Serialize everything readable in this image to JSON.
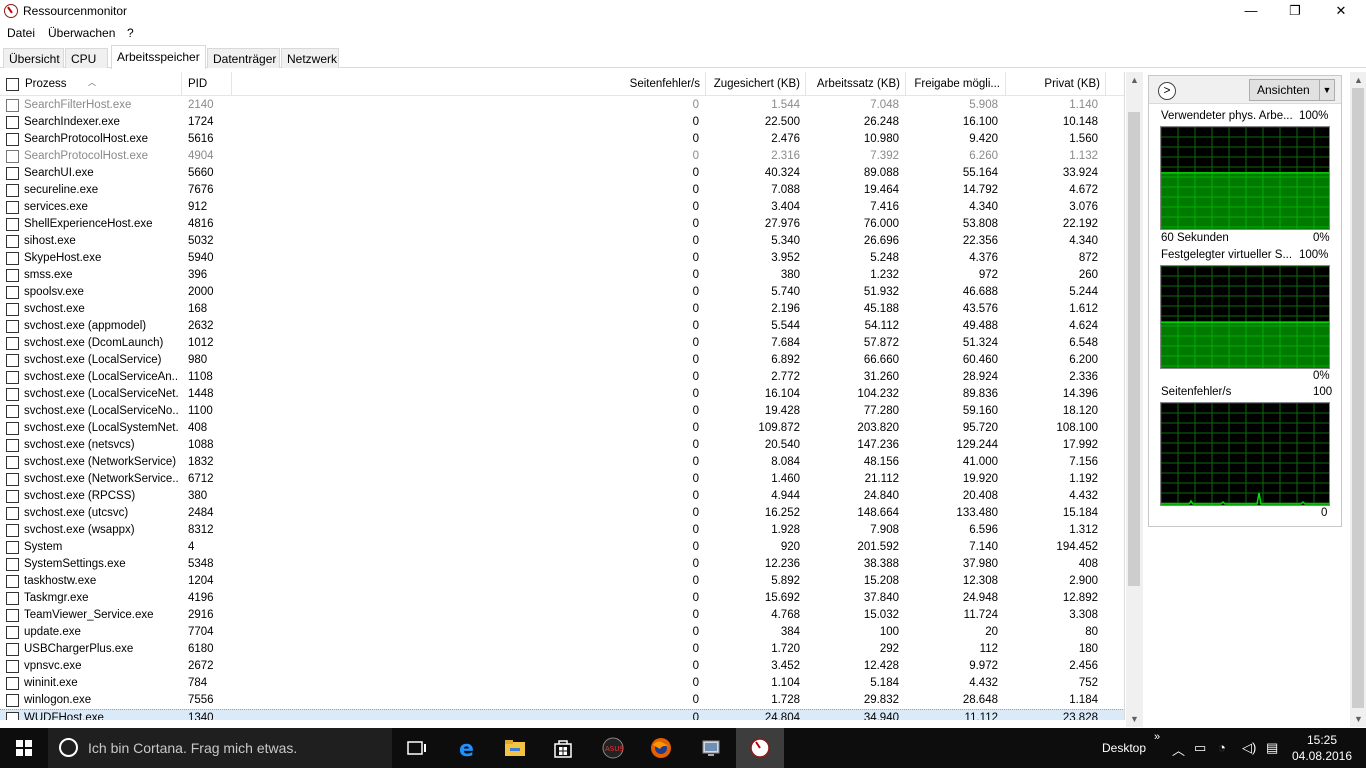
{
  "window": {
    "title": "Ressourcenmonitor",
    "min": "—",
    "max": "❐",
    "close": "✕"
  },
  "menu": [
    "Datei",
    "Überwachen",
    "?"
  ],
  "tabs": [
    "Übersicht",
    "CPU",
    "Arbeitsspeicher",
    "Datenträger",
    "Netzwerk"
  ],
  "active_tab": "Arbeitsspeicher",
  "columns": [
    "Prozess",
    "PID",
    "Seitenfehler/s",
    "Zugesichert (KB)",
    "Arbeitssatz (KB)",
    "Freigabe mögli...",
    "Privat (KB)"
  ],
  "rows": [
    {
      "name": "SearchFilterHost.exe",
      "pid": "2140",
      "pf": "0",
      "commit": "1.544",
      "ws": "7.048",
      "share": "5.908",
      "priv": "1.140",
      "dim": true
    },
    {
      "name": "SearchIndexer.exe",
      "pid": "1724",
      "pf": "0",
      "commit": "22.500",
      "ws": "26.248",
      "share": "16.100",
      "priv": "10.148"
    },
    {
      "name": "SearchProtocolHost.exe",
      "pid": "5616",
      "pf": "0",
      "commit": "2.476",
      "ws": "10.980",
      "share": "9.420",
      "priv": "1.560"
    },
    {
      "name": "SearchProtocolHost.exe",
      "pid": "4904",
      "pf": "0",
      "commit": "2.316",
      "ws": "7.392",
      "share": "6.260",
      "priv": "1.132",
      "dim": true
    },
    {
      "name": "SearchUI.exe",
      "pid": "5660",
      "pf": "0",
      "commit": "40.324",
      "ws": "89.088",
      "share": "55.164",
      "priv": "33.924"
    },
    {
      "name": "secureline.exe",
      "pid": "7676",
      "pf": "0",
      "commit": "7.088",
      "ws": "19.464",
      "share": "14.792",
      "priv": "4.672"
    },
    {
      "name": "services.exe",
      "pid": "912",
      "pf": "0",
      "commit": "3.404",
      "ws": "7.416",
      "share": "4.340",
      "priv": "3.076"
    },
    {
      "name": "ShellExperienceHost.exe",
      "pid": "4816",
      "pf": "0",
      "commit": "27.976",
      "ws": "76.000",
      "share": "53.808",
      "priv": "22.192"
    },
    {
      "name": "sihost.exe",
      "pid": "5032",
      "pf": "0",
      "commit": "5.340",
      "ws": "26.696",
      "share": "22.356",
      "priv": "4.340"
    },
    {
      "name": "SkypeHost.exe",
      "pid": "5940",
      "pf": "0",
      "commit": "3.952",
      "ws": "5.248",
      "share": "4.376",
      "priv": "872"
    },
    {
      "name": "smss.exe",
      "pid": "396",
      "pf": "0",
      "commit": "380",
      "ws": "1.232",
      "share": "972",
      "priv": "260"
    },
    {
      "name": "spoolsv.exe",
      "pid": "2000",
      "pf": "0",
      "commit": "5.740",
      "ws": "51.932",
      "share": "46.688",
      "priv": "5.244"
    },
    {
      "name": "svchost.exe",
      "pid": "168",
      "pf": "0",
      "commit": "2.196",
      "ws": "45.188",
      "share": "43.576",
      "priv": "1.612"
    },
    {
      "name": "svchost.exe (appmodel)",
      "pid": "2632",
      "pf": "0",
      "commit": "5.544",
      "ws": "54.112",
      "share": "49.488",
      "priv": "4.624"
    },
    {
      "name": "svchost.exe (DcomLaunch)",
      "pid": "1012",
      "pf": "0",
      "commit": "7.684",
      "ws": "57.872",
      "share": "51.324",
      "priv": "6.548"
    },
    {
      "name": "svchost.exe (LocalService)",
      "pid": "980",
      "pf": "0",
      "commit": "6.892",
      "ws": "66.660",
      "share": "60.460",
      "priv": "6.200"
    },
    {
      "name": "svchost.exe (LocalServiceAn...",
      "pid": "1108",
      "pf": "0",
      "commit": "2.772",
      "ws": "31.260",
      "share": "28.924",
      "priv": "2.336"
    },
    {
      "name": "svchost.exe (LocalServiceNet...",
      "pid": "1448",
      "pf": "0",
      "commit": "16.104",
      "ws": "104.232",
      "share": "89.836",
      "priv": "14.396"
    },
    {
      "name": "svchost.exe (LocalServiceNo...",
      "pid": "1100",
      "pf": "0",
      "commit": "19.428",
      "ws": "77.280",
      "share": "59.160",
      "priv": "18.120"
    },
    {
      "name": "svchost.exe (LocalSystemNet...",
      "pid": "408",
      "pf": "0",
      "commit": "109.872",
      "ws": "203.820",
      "share": "95.720",
      "priv": "108.100"
    },
    {
      "name": "svchost.exe (netsvcs)",
      "pid": "1088",
      "pf": "0",
      "commit": "20.540",
      "ws": "147.236",
      "share": "129.244",
      "priv": "17.992"
    },
    {
      "name": "svchost.exe (NetworkService)",
      "pid": "1832",
      "pf": "0",
      "commit": "8.084",
      "ws": "48.156",
      "share": "41.000",
      "priv": "7.156"
    },
    {
      "name": "svchost.exe (NetworkService...",
      "pid": "6712",
      "pf": "0",
      "commit": "1.460",
      "ws": "21.112",
      "share": "19.920",
      "priv": "1.192"
    },
    {
      "name": "svchost.exe (RPCSS)",
      "pid": "380",
      "pf": "0",
      "commit": "4.944",
      "ws": "24.840",
      "share": "20.408",
      "priv": "4.432"
    },
    {
      "name": "svchost.exe (utcsvc)",
      "pid": "2484",
      "pf": "0",
      "commit": "16.252",
      "ws": "148.664",
      "share": "133.480",
      "priv": "15.184"
    },
    {
      "name": "svchost.exe (wsappx)",
      "pid": "8312",
      "pf": "0",
      "commit": "1.928",
      "ws": "7.908",
      "share": "6.596",
      "priv": "1.312"
    },
    {
      "name": "System",
      "pid": "4",
      "pf": "0",
      "commit": "920",
      "ws": "201.592",
      "share": "7.140",
      "priv": "194.452"
    },
    {
      "name": "SystemSettings.exe",
      "pid": "5348",
      "pf": "0",
      "commit": "12.236",
      "ws": "38.388",
      "share": "37.980",
      "priv": "408"
    },
    {
      "name": "taskhostw.exe",
      "pid": "1204",
      "pf": "0",
      "commit": "5.892",
      "ws": "15.208",
      "share": "12.308",
      "priv": "2.900"
    },
    {
      "name": "Taskmgr.exe",
      "pid": "4196",
      "pf": "0",
      "commit": "15.692",
      "ws": "37.840",
      "share": "24.948",
      "priv": "12.892"
    },
    {
      "name": "TeamViewer_Service.exe",
      "pid": "2916",
      "pf": "0",
      "commit": "4.768",
      "ws": "15.032",
      "share": "11.724",
      "priv": "3.308"
    },
    {
      "name": "update.exe",
      "pid": "7704",
      "pf": "0",
      "commit": "384",
      "ws": "100",
      "share": "20",
      "priv": "80"
    },
    {
      "name": "USBChargerPlus.exe",
      "pid": "6180",
      "pf": "0",
      "commit": "1.720",
      "ws": "292",
      "share": "112",
      "priv": "180"
    },
    {
      "name": "vpnsvc.exe",
      "pid": "2672",
      "pf": "0",
      "commit": "3.452",
      "ws": "12.428",
      "share": "9.972",
      "priv": "2.456"
    },
    {
      "name": "wininit.exe",
      "pid": "784",
      "pf": "0",
      "commit": "1.104",
      "ws": "5.184",
      "share": "4.432",
      "priv": "752"
    },
    {
      "name": "winlogon.exe",
      "pid": "7556",
      "pf": "0",
      "commit": "1.728",
      "ws": "29.832",
      "share": "28.648",
      "priv": "1.184"
    },
    {
      "name": "WUDFHost.exe",
      "pid": "1340",
      "pf": "0",
      "commit": "24.804",
      "ws": "34.940",
      "share": "11.112",
      "priv": "23.828",
      "selected": true
    }
  ],
  "graphs": {
    "toggle": ">",
    "view_button": "Ansichten",
    "g1": {
      "title": "Verwendeter phys. Arbe...",
      "max": "100%",
      "time": "60 Sekunden",
      "min": "0%",
      "level_percent": 55,
      "color": "#00e000"
    },
    "g2": {
      "title": "Festgelegter virtueller S...",
      "max": "100%",
      "min": "0%",
      "level_percent": 45,
      "color": "#00e000"
    },
    "g3": {
      "title": "Seitenfehler/s",
      "max": "100",
      "min": "0",
      "color": "#00e000"
    }
  },
  "taskbar": {
    "search_placeholder": "Ich bin Cortana. Frag mich etwas.",
    "desktop": "Desktop",
    "time": "15:25",
    "date": "04.08.2016"
  }
}
